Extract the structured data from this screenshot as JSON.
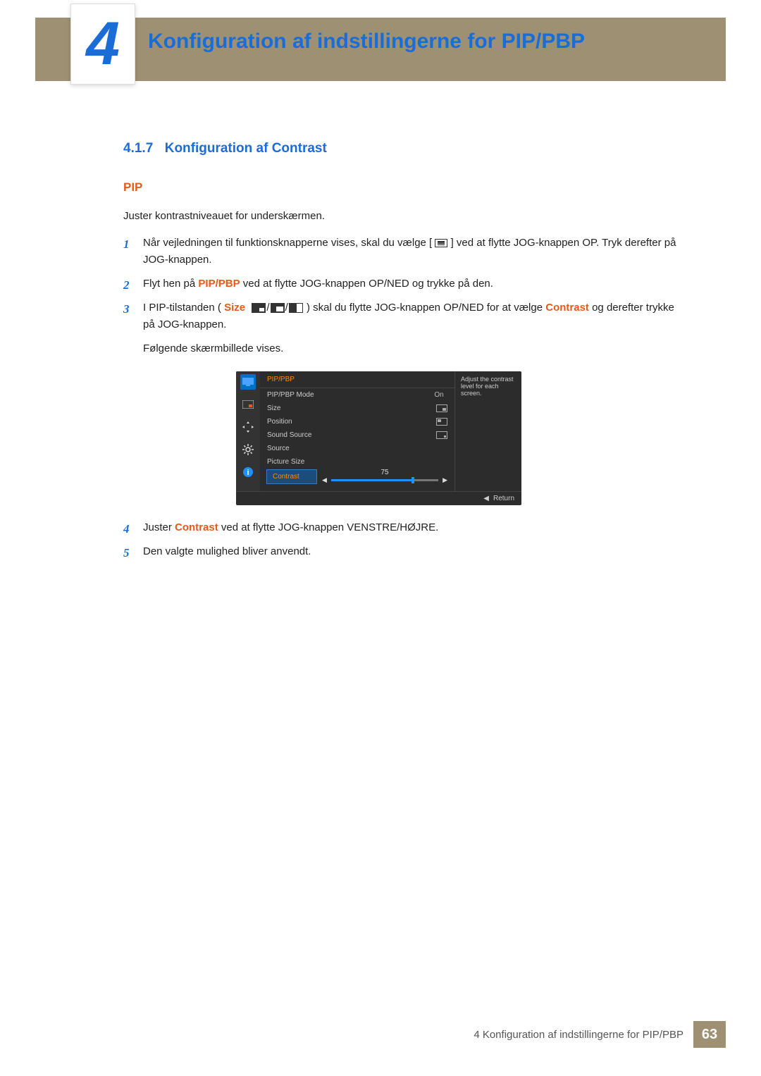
{
  "chapter_number": "4",
  "chapter_title": "Konfiguration af indstillingerne for PIP/PBP",
  "section_number": "4.1.7",
  "section_title": "Konfiguration af Contrast",
  "sub_head": "PIP",
  "intro": "Juster kontrastniveauet for underskærmen.",
  "steps": {
    "1a": "Når vejledningen til funktionsknapperne vises, skal du vælge [",
    "1b": "] ved at flytte JOG-knappen OP. Tryk derefter på JOG-knappen.",
    "2a": "Flyt hen på ",
    "2_bold": "PIP/PBP",
    "2b": " ved at flytte JOG-knappen OP/NED og trykke på den.",
    "3a": "I PIP-tilstanden (",
    "3_size": "Size",
    "3b": ") skal du flytte JOG-knappen OP/NED for at vælge ",
    "3_contrast": "Contrast",
    "3c": " og derefter trykke på JOG-knappen.",
    "3d": "Følgende skærmbillede vises.",
    "4a": "Juster ",
    "4_contrast": "Contrast",
    "4b": " ved at flytte JOG-knappen VENSTRE/HØJRE.",
    "5": "Den valgte mulighed bliver anvendt."
  },
  "osd": {
    "title": "PIP/PBP",
    "help": "Adjust the contrast level for each screen.",
    "rows": {
      "mode": "PIP/PBP Mode",
      "mode_val": "On",
      "size": "Size",
      "position": "Position",
      "sound": "Sound Source",
      "source": "Source",
      "picsize": "Picture Size",
      "contrast": "Contrast"
    },
    "slider_value": "75",
    "return": "Return"
  },
  "footer_text": "4 Konfiguration af indstillingerne for PIP/PBP",
  "page_number": "63"
}
